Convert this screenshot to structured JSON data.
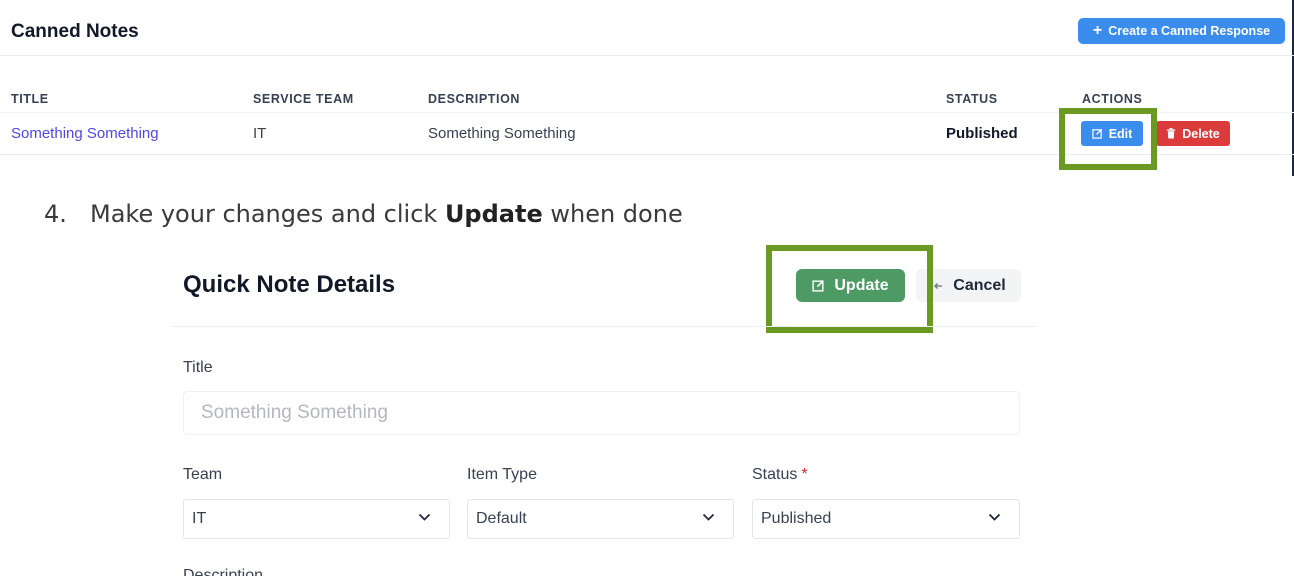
{
  "canned_notes": {
    "title": "Canned Notes",
    "create_button_label": "Create a Canned Response",
    "columns": [
      "TITLE",
      "SERVICE TEAM",
      "DESCRIPTION",
      "STATUS",
      "ACTIONS"
    ],
    "rows": [
      {
        "title": "Something Something",
        "service_team": "IT",
        "description": "Something Something",
        "status": "Published"
      }
    ],
    "edit_label": "Edit",
    "delete_label": "Delete",
    "highlight_color": "#6b9a22"
  },
  "instruction": {
    "number": "4.",
    "text_before": "Make your changes and click ",
    "bold": "Update",
    "text_after": " when done"
  },
  "quick_note_details": {
    "title": "Quick Note Details",
    "update_label": "Update",
    "cancel_label": "Cancel",
    "fields": {
      "title_label": "Title",
      "title_placeholder": "Something Something",
      "team_label": "Team",
      "team_value": "IT",
      "item_type_label": "Item Type",
      "item_type_value": "Default",
      "status_label": "Status",
      "status_required": "*",
      "status_value": "Published",
      "description_label": "Description"
    }
  },
  "colors": {
    "primary_blue": "#3b8ded",
    "danger_red": "#dc3b3b",
    "update_green": "#4e9a64",
    "link_purple": "#4f46e5"
  }
}
